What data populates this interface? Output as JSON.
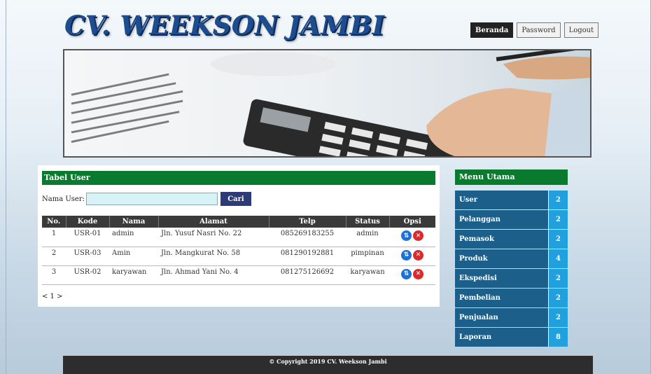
{
  "header": {
    "title": "CV. WEEKSON JAMBI",
    "nav": [
      {
        "label": "Beranda",
        "active": true
      },
      {
        "label": "Password",
        "active": false
      },
      {
        "label": "Logout",
        "active": false
      }
    ]
  },
  "main": {
    "panel_title": "Tabel User",
    "search": {
      "label": "Nama User:",
      "value": "",
      "button": "Cari"
    },
    "columns": [
      "No.",
      "Kode",
      "Nama",
      "Alamat",
      "Telp",
      "Status",
      "Opsi"
    ],
    "rows": [
      {
        "no": "1",
        "kode": "USR-01",
        "nama": "admin",
        "alamat": "Jln. Yusuf Nasri No. 22",
        "telp": "085269183255",
        "status": "admin"
      },
      {
        "no": "2",
        "kode": "USR-03",
        "nama": "Amin",
        "alamat": "Jln. Mangkurat No. 58",
        "telp": "081290192881",
        "status": "pimpinan"
      },
      {
        "no": "3",
        "kode": "USR-02",
        "nama": "karyawan",
        "alamat": "Jln. Ahmad Yani No. 4",
        "telp": "081275126692",
        "status": "karyawan"
      }
    ],
    "pager": "< 1 >"
  },
  "sidebar": {
    "title": "Menu Utama",
    "items": [
      {
        "label": "User",
        "count": "2"
      },
      {
        "label": "Pelanggan",
        "count": "2"
      },
      {
        "label": "Pemasok",
        "count": "2"
      },
      {
        "label": "Produk",
        "count": "4"
      },
      {
        "label": "Ekspedisi",
        "count": "2"
      },
      {
        "label": "Pembelian",
        "count": "2"
      },
      {
        "label": "Penjualan",
        "count": "2"
      },
      {
        "label": "Laporan",
        "count": "8"
      }
    ]
  },
  "footer": {
    "text": "© Copyright 2019 CV. Weekson Jambi"
  },
  "icons": {
    "edit": "swap-arrows-icon",
    "delete": "close-circle-icon"
  },
  "colors": {
    "green_header": "#0a7a2e",
    "menu_blue": "#1c5f8a",
    "count_blue": "#21a0dd",
    "title_blue": "#1d4d8f"
  }
}
